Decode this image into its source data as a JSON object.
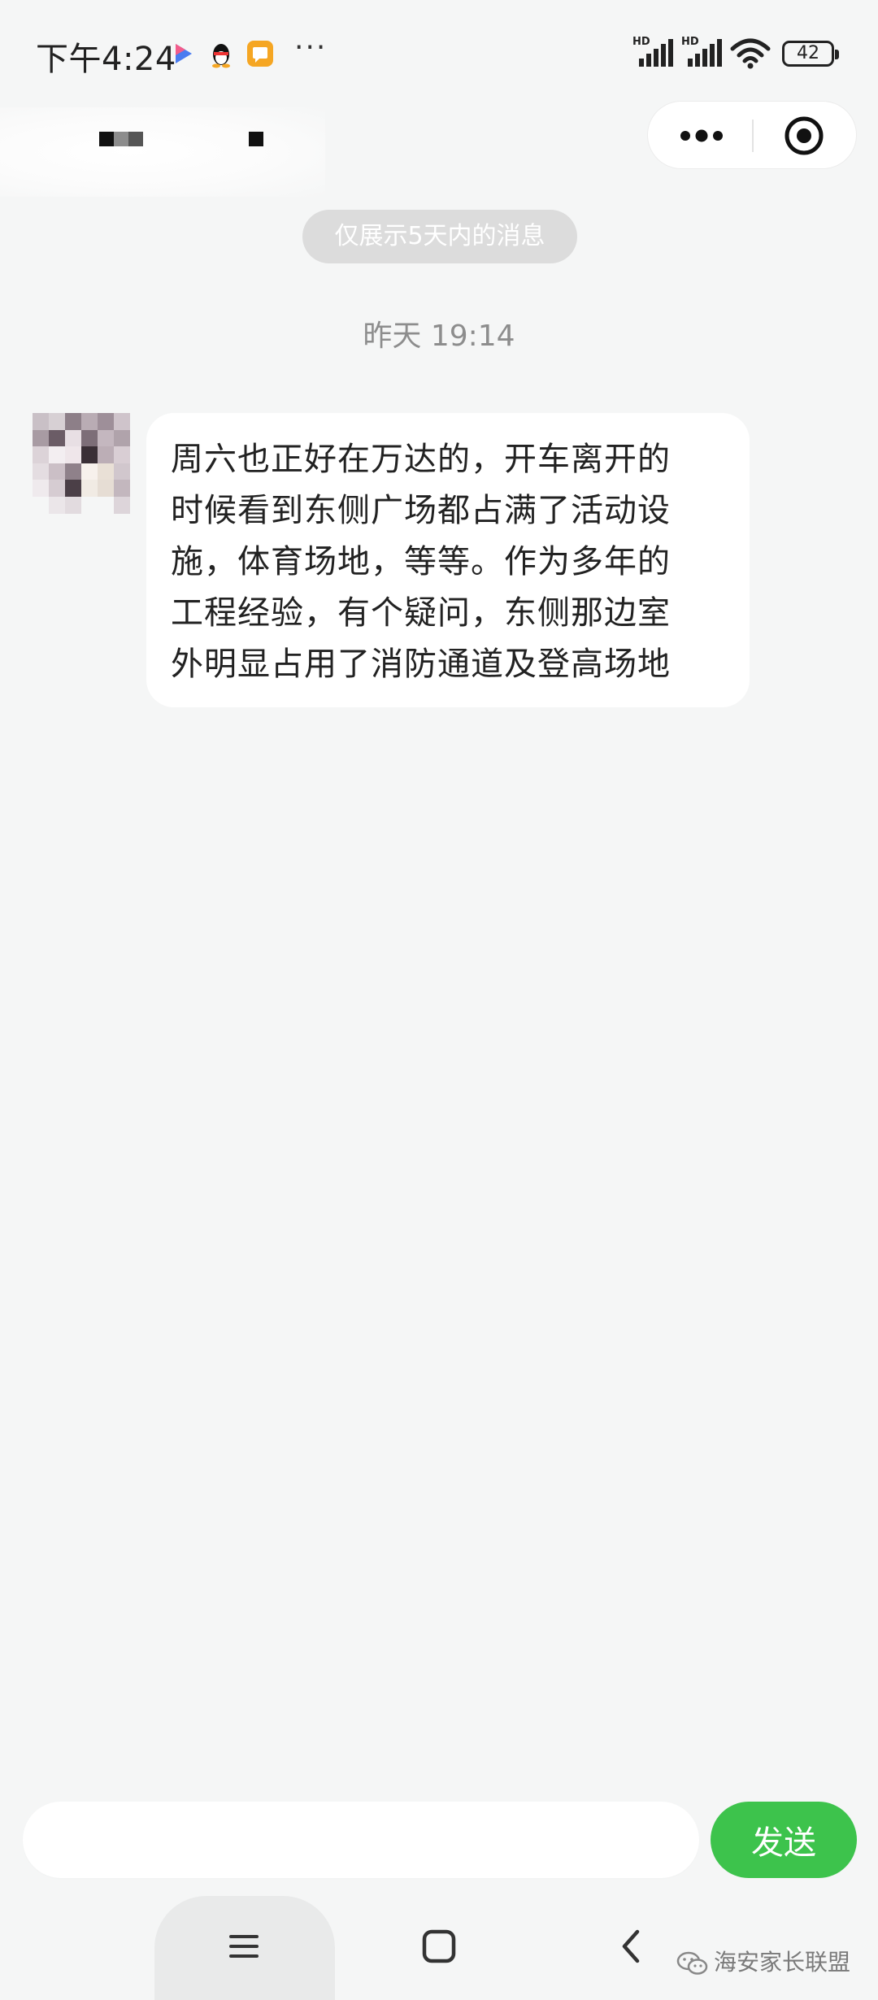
{
  "status_bar": {
    "time": "下午4:24",
    "left_icons": [
      "video-app-icon",
      "qq-penguin-icon",
      "note-app-icon"
    ],
    "more": "···",
    "network_labels": [
      "HD",
      "HD"
    ],
    "battery": "42"
  },
  "header": {
    "capsule_icons": [
      "more-dots-icon",
      "close-circle-icon"
    ]
  },
  "chat": {
    "notice": "仅展示5天内的消息",
    "timestamp": "昨天 19:14",
    "messages": [
      {
        "lines": [
          "周六也正好在万达的，开车离开的",
          "时候看到东侧广场都占满了活动设",
          "施，体育场地，等等。作为多年的",
          "工程经验，有个疑问，东侧那边室",
          "外明显占用了消防通道及登高场地"
        ]
      }
    ]
  },
  "input_bar": {
    "placeholder": "",
    "send_label": "发送",
    "send_color": "#3dc34c"
  },
  "nav": {
    "icons": [
      "menu-icon",
      "home-square-icon",
      "back-chevron-icon"
    ]
  },
  "watermark": {
    "text": "海安家长联盟"
  }
}
